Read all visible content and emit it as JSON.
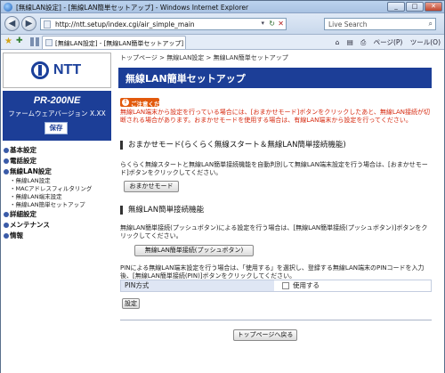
{
  "window": {
    "title": "[無線LAN設定] - [無線LAN簡単セットアップ] - Windows Internet Explorer",
    "min": "_",
    "max": "□",
    "close": "✕"
  },
  "nav": {
    "back": "◀",
    "forward": "▶",
    "url": "http://ntt.setup/index.cgi/air_simple_main",
    "refresh": "↻",
    "stop": "✕",
    "search_placeholder": "Live Search",
    "search_icon": "⌕"
  },
  "tabs": {
    "tab_title": "[無線LAN設定] - [無線LAN簡単セットアップ]",
    "toolbar": [
      "⌂",
      "▤",
      "⎙",
      "ページ(P)",
      "ツール(O)"
    ]
  },
  "sidebar": {
    "logo_text": "NTT",
    "product": "PR-200NE",
    "firmware": "ファームウェアバージョン X.XX",
    "save_label": "保存",
    "menu": {
      "basic": "基本設定",
      "phone": "電話設定",
      "wlan": "無線LAN設定",
      "wlan_sub": [
        "無線LAN設定",
        "MACアドレスフィルタリング",
        "無線LAN端末設定",
        "無線LAN簡単セットアップ"
      ],
      "advanced": "詳細設定",
      "maintenance": "メンテナンス",
      "info": "情報"
    }
  },
  "main": {
    "breadcrumb": [
      "トップページ",
      "無線LAN設定",
      "無線LAN簡単セットアップ"
    ],
    "breadcrumb_sep": ">",
    "page_title": "無線LAN簡単セットアップ",
    "notice_badge": "ご注意ください",
    "notice_text": "無線LAN端末から設定を行っている場合には、[おまかせモード]ボタンをクリックしたあと、無線LAN接続が切断される場合があります。おまかせモードを使用する場合は、有線LAN端末から設定を行ってください。",
    "section1_title": "おまかせモード(らくらく無線スタート＆無線LAN簡単接続機能)",
    "section1_text": "らくらく無線スタートと無線LAN簡単接続機能を自動判別して無線LAN端末設定を行う場合は、[おまかせモード]ボタンをクリックしてください。",
    "omakase_btn": "おまかせモード",
    "section2_title": "無線LAN簡単接続機能",
    "section2_text": "無線LAN簡単接続(プッシュボタン)による設定を行う場合は、[無線LAN簡単接続(プッシュボタン)]ボタンをクリックしてください。",
    "push_btn": "無線LAN簡単接続(プッシュボタン)",
    "pin_text": "PINによる無線LAN端末設定を行う場合は、「使用する」を選択し、登録する無線LAN端末のPINコードを入力後、[無線LAN簡単接続(PIN)]ボタンをクリックしてください。",
    "pin_label": "PIN方式",
    "pin_use": "使用する",
    "set_btn": "設定",
    "back_top_btn": "トップページへ戻る"
  }
}
